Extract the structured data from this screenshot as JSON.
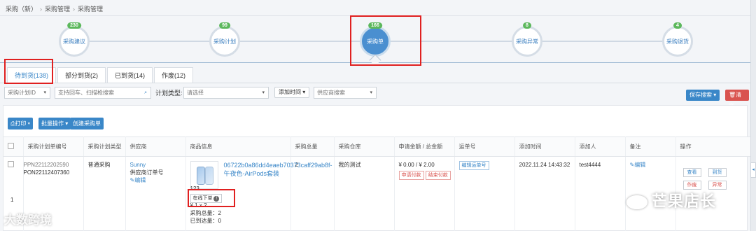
{
  "breadcrumb": [
    "采购（新）",
    "采购管理",
    "采购管理"
  ],
  "steps": [
    {
      "label": "采购建议",
      "count": "230"
    },
    {
      "label": "采购计划",
      "count": "99"
    },
    {
      "label": "采购单",
      "count": "166"
    },
    {
      "label": "采购异常",
      "count": "8"
    },
    {
      "label": "采购退货",
      "count": "4"
    }
  ],
  "tabs": [
    "待到货(138)",
    "部分到货(2)",
    "已到货(14)",
    "作废(12)"
  ],
  "filters": {
    "plan_id": "采购计划ID",
    "search_placeholder": "支持回车、扫描枪搜索",
    "plan_type_label": "计划类型:",
    "plan_type_value": "请选择",
    "add_time": "添加时间",
    "supplier_search": "供应商搜索",
    "save_search": "保存搜索",
    "clear": "清空"
  },
  "toolbar": {
    "print": "打印",
    "batch": "批量操作",
    "create": "创建采购单"
  },
  "table": {
    "headers": [
      "采购计划单编号",
      "采购计划类型",
      "供应商",
      "商品信息",
      "采购总量",
      "采购仓库",
      "申请金额 / 总金额",
      "运单号",
      "添加时间",
      "添加人",
      "备注",
      "操作"
    ],
    "row": {
      "plan_no_1": "PPN22112202590",
      "plan_no_2": "PON22112407360",
      "index": "1",
      "plan_type": "普通采购",
      "supplier_name": "Sunny",
      "supplier_sub": "供应商订单号",
      "edit": "编辑",
      "product_title": "06722b0a86dd4eaeb70373caff29ab8f-午夜色-AirPods套装",
      "online_order": "在线下单",
      "sku_line": "123",
      "price_line": "¥ 1 x 2",
      "purchase_qty": "采购总量：2",
      "arrived_qty": "已到达量：0",
      "total_qty": "2",
      "warehouse": "我的测试",
      "amount": "¥ 0.00 / ¥ 2.00",
      "apply_pay": "申请付款",
      "settle_pay": "结束付款",
      "edit_waybill": "编辑运单号",
      "add_time": "2022.11.24 14:43:32",
      "adder": "test4444",
      "remark_edit": "编辑",
      "actions": [
        "查看",
        "到货",
        "作废",
        "异常"
      ]
    }
  },
  "watermark_left": "大数跨境",
  "watermark_right": "芒果店长",
  "colors": {
    "accent": "#3a87c8",
    "success": "#5cb85c",
    "danger": "#d9534f",
    "highlight": "#e02020"
  }
}
